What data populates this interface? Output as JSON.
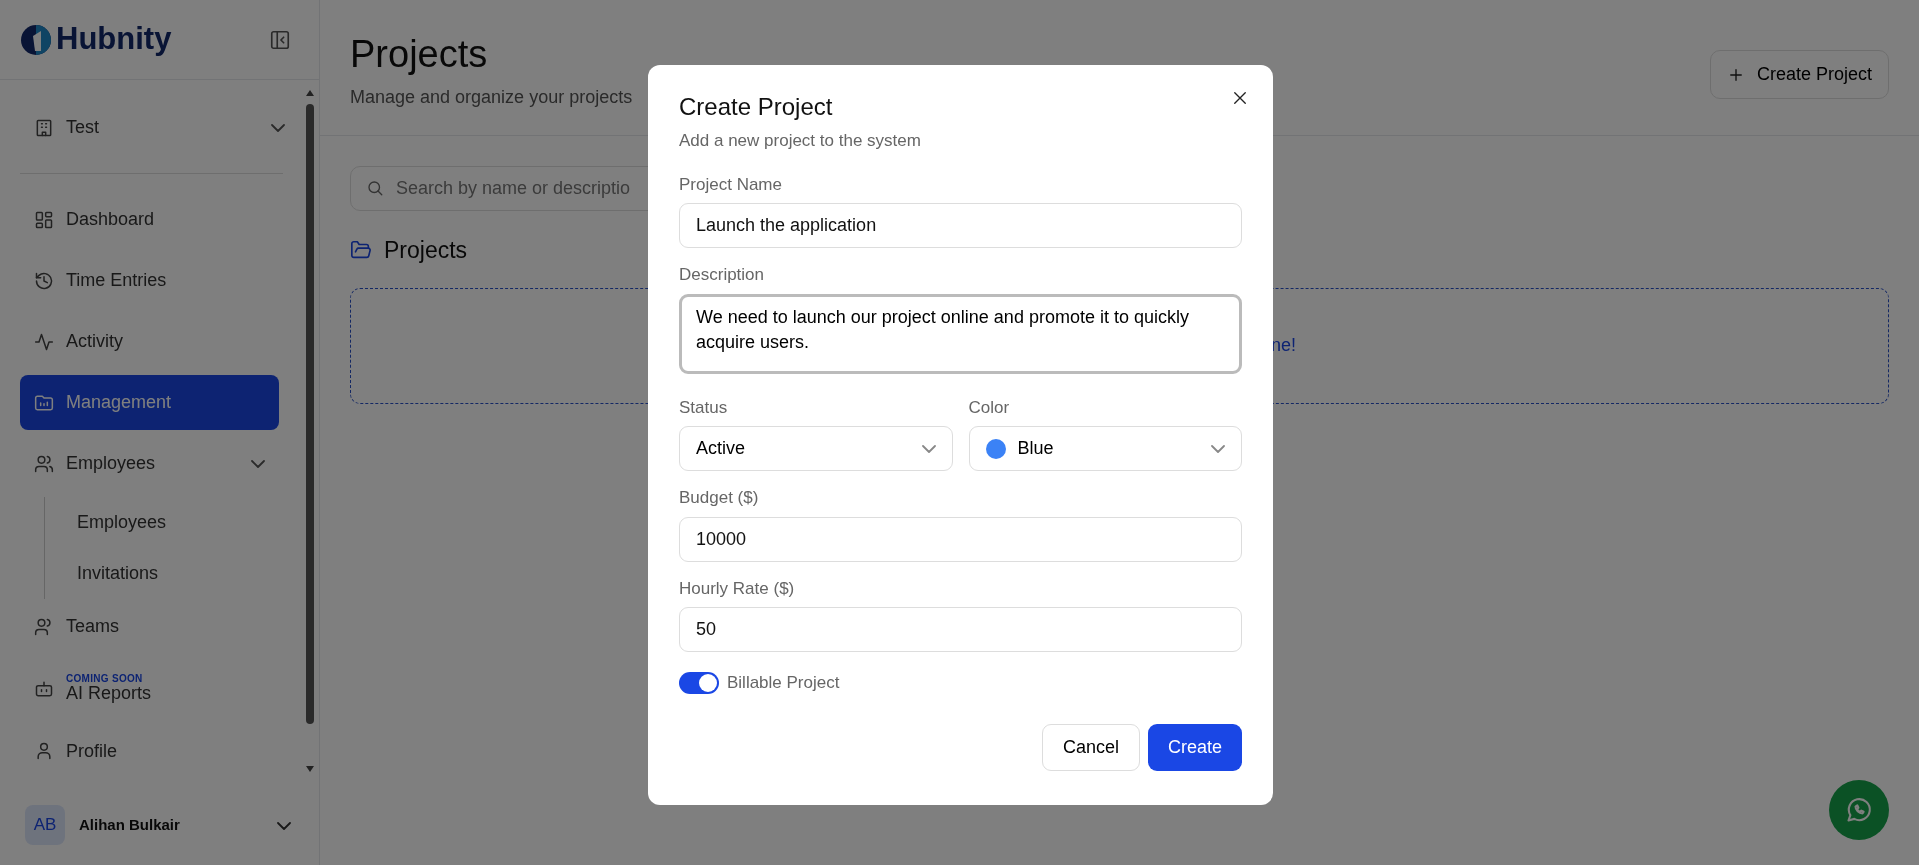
{
  "sidebar": {
    "brand": "Hubnity",
    "workspace": "Test",
    "nav": [
      {
        "label": "Dashboard",
        "selected": false
      },
      {
        "label": "Time Entries",
        "selected": false
      },
      {
        "label": "Activity",
        "selected": false
      },
      {
        "label": "Management",
        "selected": true
      },
      {
        "label": "Employees",
        "selected": false,
        "expanded": true,
        "children": [
          {
            "label": "Employees",
            "selected": false
          },
          {
            "label": "Invitations",
            "selected": false
          }
        ]
      },
      {
        "label": "Teams",
        "selected": false
      },
      {
        "label": "AI Reports",
        "selected": false,
        "badge": "COMING SOON"
      },
      {
        "label": "Profile",
        "selected": false
      }
    ],
    "user": {
      "initials": "AB",
      "name": "Alihan Bulkair"
    }
  },
  "header": {
    "title": "Projects",
    "subtitle": "Manage and organize your projects",
    "create_button": "Create Project"
  },
  "search": {
    "placeholder": "Search by name or descriptio"
  },
  "section": {
    "title": "Projects",
    "empty_text": "ne!"
  },
  "dialog": {
    "title": "Create Project",
    "subtitle": "Add a new project to the system",
    "project_name": {
      "label": "Project Name",
      "value": "Launch the application"
    },
    "description": {
      "label": "Description",
      "value": "We need to launch our project online and promote it to quickly acquire users."
    },
    "status": {
      "label": "Status",
      "value": "Active"
    },
    "color": {
      "label": "Color",
      "value": "Blue",
      "color": "#3b82f6"
    },
    "budget": {
      "label": "Budget ($)",
      "value": "10000"
    },
    "hourly_rate": {
      "label": "Hourly Rate ($)",
      "value": "50"
    },
    "billable": {
      "label": "Billable Project",
      "on": true
    },
    "buttons": {
      "cancel": "Cancel",
      "create": "Create"
    }
  }
}
